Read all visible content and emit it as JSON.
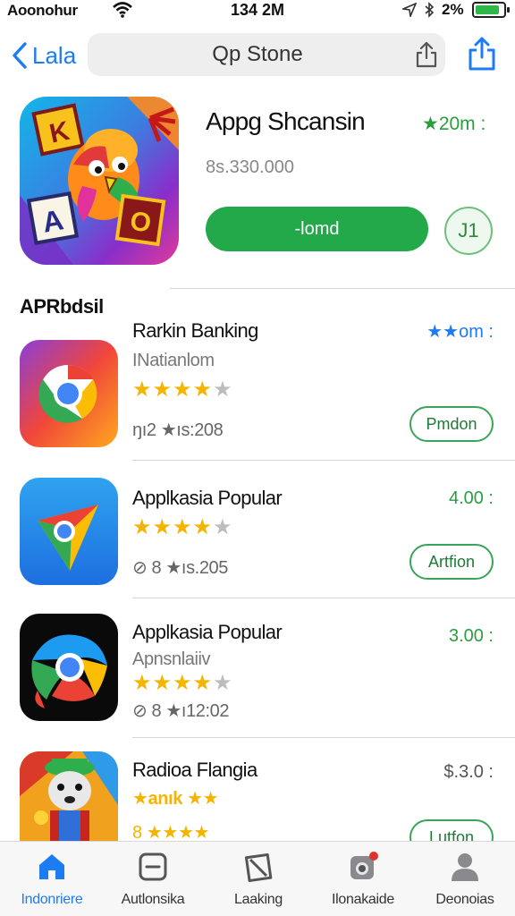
{
  "status_bar": {
    "carrier": "Aoonohur",
    "time": "134 2M",
    "battery_pct": "2%"
  },
  "nav": {
    "back_label": "Lala",
    "search_text": "Qp Stone"
  },
  "featured": {
    "title": "Appg Shcansin",
    "rating": "★20m :",
    "price": "8s.330.000",
    "button_label": "-lomd",
    "circle_label": "J1"
  },
  "section": {
    "title": "APRbdsil"
  },
  "apps": [
    {
      "name": "Rarkin Banking",
      "subtitle": "INatianlom",
      "stars": 4,
      "meta": "ŋı2 ★ıs:208",
      "price": "★★om :",
      "button": "Pmdon",
      "icon": "chrome-orange-icon"
    },
    {
      "name": "Applkasia Popular",
      "subtitle": "",
      "stars": 4,
      "meta": "⊘ 8 ★ıs.205",
      "price": "4.00 :",
      "button": "Artfion",
      "icon": "chrome-blue-icon"
    },
    {
      "name": "Applkasia Popular",
      "subtitle": "Apnsnlaiiv",
      "stars": 4.5,
      "meta": "⊘ 8 ★ı12:02",
      "price": "3.00 :",
      "button": "",
      "icon": "chrome-parrot-icon"
    },
    {
      "name": "Radioa Flangia",
      "subtitle": "★anık ★★",
      "stars": 4.5,
      "meta": "8 ★★★★",
      "price": "$.3.0 :",
      "button": "Lutfon",
      "icon": "game-character-icon"
    }
  ],
  "tabs": [
    {
      "label": "Indonriere",
      "icon": "home-icon",
      "active": true
    },
    {
      "label": "Autlonsika",
      "icon": "square-minus-icon",
      "active": false
    },
    {
      "label": "Laaking",
      "icon": "ticket-icon",
      "active": false
    },
    {
      "label": "Ilonakaide",
      "icon": "camera-icon",
      "active": false
    },
    {
      "label": "Deonoias",
      "icon": "person-icon",
      "active": false
    }
  ],
  "colors": {
    "accent_blue": "#1e7cf2",
    "accent_green": "#23a94a",
    "star": "#f4b400"
  }
}
